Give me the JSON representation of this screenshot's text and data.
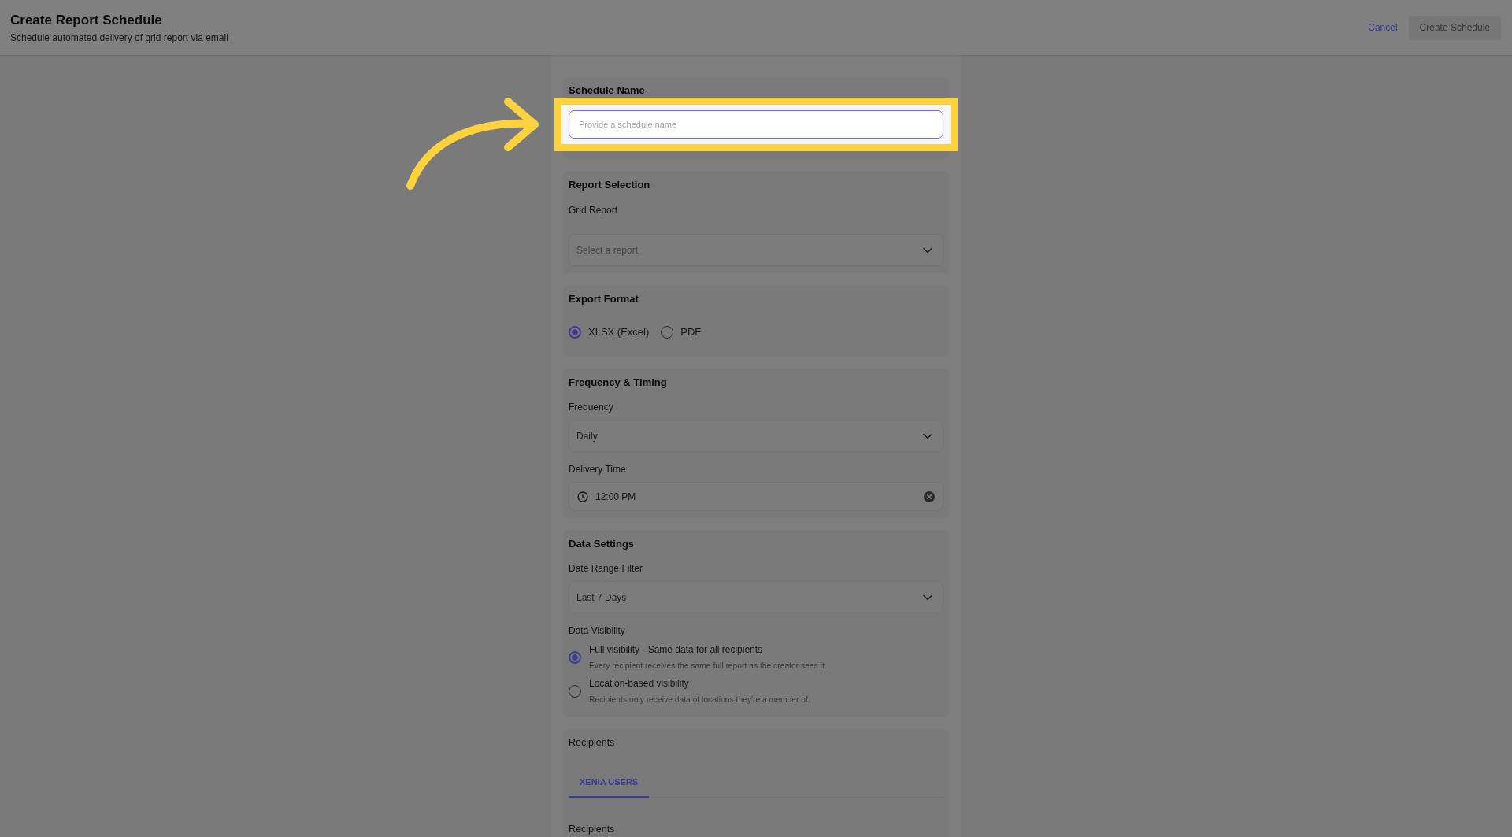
{
  "header": {
    "title": "Create Report Schedule",
    "subtitle": "Schedule automated delivery of grid report via email",
    "actions": [
      {
        "kind": "link",
        "label": "Cancel"
      },
      {
        "kind": "button",
        "label": "Create Schedule",
        "disabled": true
      }
    ]
  },
  "sections": [
    {
      "heading": "Schedule Name",
      "highlighted": true,
      "fields": [
        {
          "kind": "text",
          "placeholder": "Provide a schedule name",
          "focused": true
        }
      ]
    },
    {
      "heading": "Report Selection",
      "fields": [
        {
          "kind": "select",
          "label": "Grid Report",
          "placeholder": "Select a report"
        }
      ]
    },
    {
      "heading": "Export Format",
      "fields": [
        {
          "kind": "radio_row",
          "options": [
            {
              "label": "XLSX (Excel)",
              "selected": true
            },
            {
              "label": "PDF",
              "selected": false
            }
          ]
        }
      ]
    },
    {
      "heading": "Frequency & Timing",
      "fields": [
        {
          "kind": "select",
          "label": "Frequency",
          "value": "Daily"
        },
        {
          "kind": "time",
          "label": "Delivery Time",
          "value": "12:00 PM"
        }
      ]
    },
    {
      "heading": "Data Settings",
      "fields": [
        {
          "kind": "select",
          "label": "Date Range Filter",
          "value": "Last 7 Days"
        },
        {
          "kind": "radio_list",
          "label": "Data Visibility",
          "options": [
            {
              "label": "Full visibility - Same data for all recipients",
              "description": "Every recipient receives the same full report as the creator sees it.",
              "selected": true
            },
            {
              "label": "Location-based visibility",
              "description": "Recipients only receive data of locations they're a member of.",
              "selected": false
            }
          ]
        }
      ]
    },
    {
      "fields": [
        {
          "kind": "label",
          "text": "Recipients"
        },
        {
          "kind": "tabs",
          "tabs": [
            {
              "label": "XENIA USERS",
              "selected": true
            }
          ]
        },
        {
          "kind": "label",
          "text": "Recipients"
        }
      ]
    }
  ]
}
